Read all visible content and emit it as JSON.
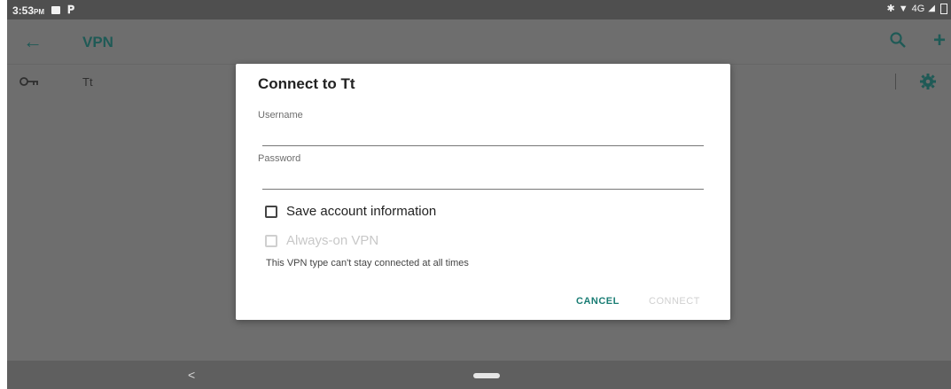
{
  "status_bar": {
    "time": "3:53",
    "ampm": "PM",
    "icons": [
      "image-notification-icon",
      "p-notification-icon"
    ],
    "right_icons": [
      "bluetooth-icon",
      "wifi-icon",
      "signal-icon",
      "battery-icon"
    ],
    "network": "4G"
  },
  "app_bar": {
    "title": "VPN",
    "back_icon": "arrow-left",
    "actions": [
      "search-icon",
      "add-icon"
    ]
  },
  "vpn_list": [
    {
      "name": "Tt",
      "icon": "key-icon",
      "settings_icon": "gear-icon"
    }
  ],
  "dialog": {
    "title": "Connect to Tt",
    "username_label": "Username",
    "username_value": "",
    "password_label": "Password",
    "password_value": "",
    "save_label": "Save account information",
    "save_checked": false,
    "always_on_label": "Always-on VPN",
    "always_on_checked": false,
    "always_on_enabled": false,
    "hint": "This VPN type can't stay connected at all times",
    "cancel_label": "CANCEL",
    "connect_label": "CONNECT",
    "connect_enabled": false
  },
  "nav_bar": {
    "back": "<"
  },
  "colors": {
    "accent": "#1a7d74",
    "dim_accent": "#1f5a56",
    "scrim": "#6e6e6e",
    "status": "#4f4f4f"
  }
}
